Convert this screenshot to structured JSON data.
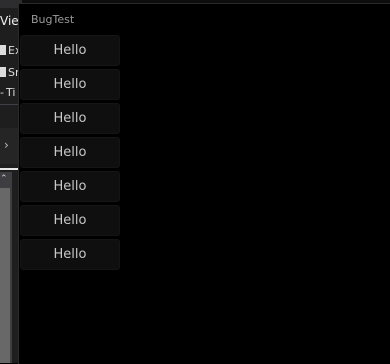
{
  "window": {
    "title": "BugTest"
  },
  "items": [
    "Hello",
    "Hello",
    "Hello",
    "Hello",
    "Hello",
    "Hello",
    "Hello"
  ],
  "background_ide": {
    "menu_label": "View",
    "tree_rows": [
      "Ex",
      "Sn",
      "Ti"
    ]
  }
}
